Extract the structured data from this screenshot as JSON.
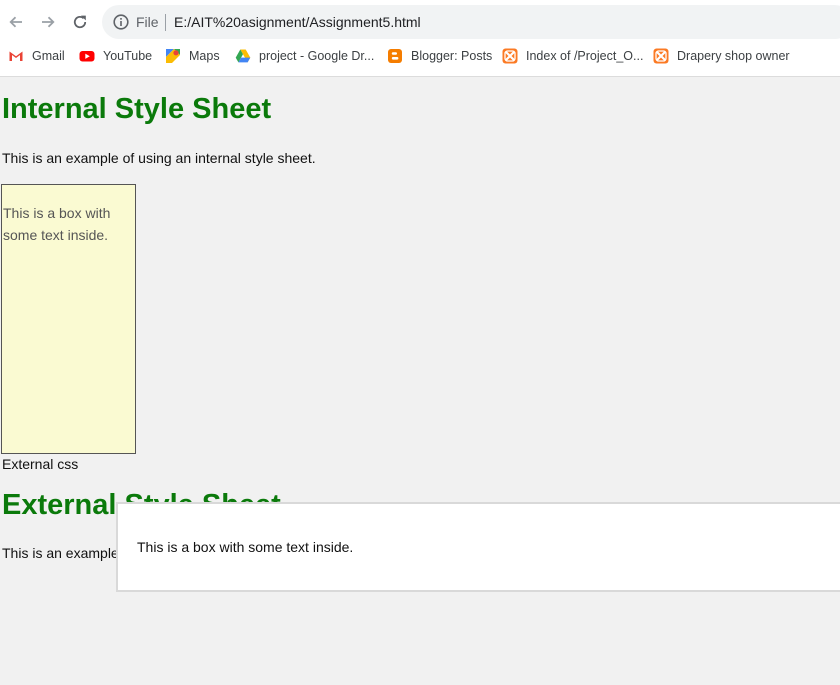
{
  "browser": {
    "back_icon": "arrow-left-icon",
    "forward_icon": "arrow-right-icon",
    "reload_icon": "reload-icon",
    "info_icon": "info-icon",
    "file_label": "File",
    "url": "E:/AIT%20asignment/Assignment5.html"
  },
  "bookmarks": [
    {
      "label": "Gmail",
      "icon": "gmail-icon"
    },
    {
      "label": "YouTube",
      "icon": "youtube-icon"
    },
    {
      "label": "Maps",
      "icon": "maps-icon"
    },
    {
      "label": "project - Google Dr...",
      "icon": "google-drive-icon"
    },
    {
      "label": "Blogger: Posts",
      "icon": "blogger-icon"
    },
    {
      "label": "Index of /Project_O...",
      "icon": "xampp-icon"
    },
    {
      "label": "Drapery shop owner",
      "icon": "xampp-icon"
    }
  ],
  "page": {
    "internal": {
      "heading": "Internal Style Sheet",
      "paragraph": "This is an example of using an internal style sheet.",
      "box_text": "This is a box with some text inside."
    },
    "external_caption": "External css",
    "external": {
      "heading": "External Style Sheet",
      "paragraph": "This is an example of using an external style sheet.",
      "box_text": "This is a box with some text inside."
    }
  },
  "colors": {
    "heading_green": "#0b7a0b",
    "internal_box_bg": "#fafad2",
    "page_bg": "#f1f1f1"
  }
}
